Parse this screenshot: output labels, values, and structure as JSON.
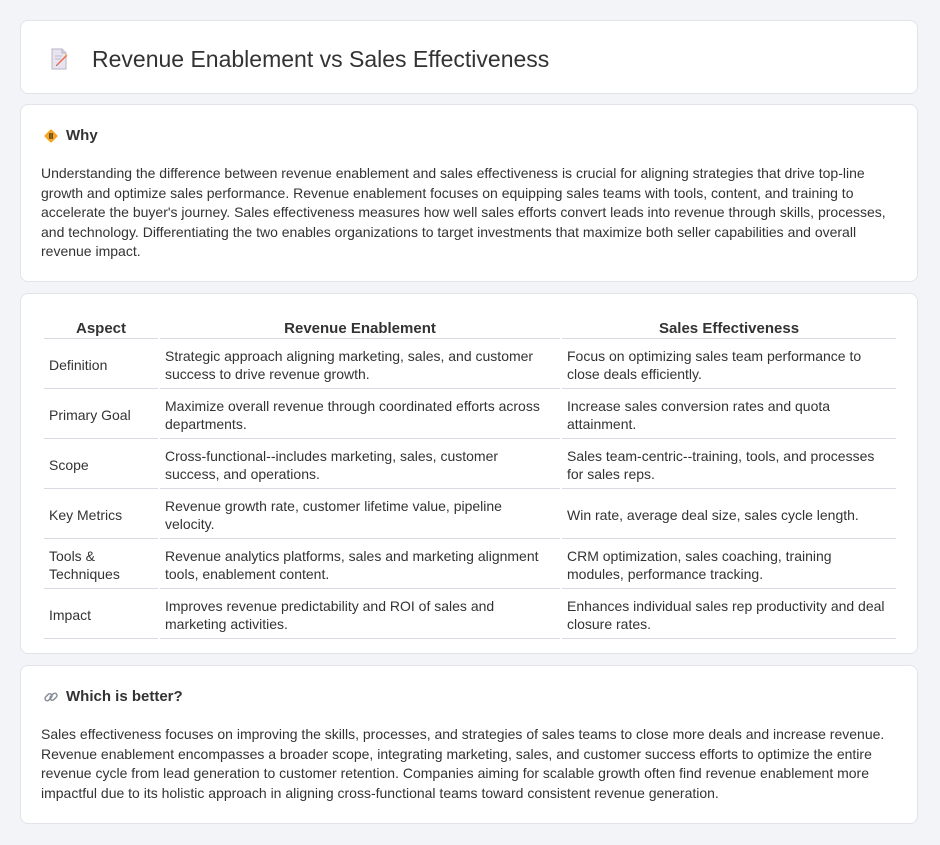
{
  "header": {
    "title": "Revenue Enablement vs Sales Effectiveness",
    "icon": "document-pencil-icon"
  },
  "why": {
    "heading": "Why",
    "icon": "diamond-sign-icon",
    "body": "Understanding the difference between revenue enablement and sales effectiveness is crucial for aligning strategies that drive top-line growth and optimize sales performance. Revenue enablement focuses on equipping sales teams with tools, content, and training to accelerate the buyer's journey. Sales effectiveness measures how well sales efforts convert leads into revenue through skills, processes, and technology. Differentiating the two enables organizations to target investments that maximize both seller capabilities and overall revenue impact."
  },
  "comparison": {
    "columns": [
      "Aspect",
      "Revenue Enablement",
      "Sales Effectiveness"
    ],
    "rows": [
      [
        "Definition",
        "Strategic approach aligning marketing, sales, and customer success to drive revenue growth.",
        "Focus on optimizing sales team performance to close deals efficiently."
      ],
      [
        "Primary Goal",
        "Maximize overall revenue through coordinated efforts across departments.",
        "Increase sales conversion rates and quota attainment."
      ],
      [
        "Scope",
        "Cross-functional--includes marketing, sales, customer success, and operations.",
        "Sales team-centric--training, tools, and processes for sales reps."
      ],
      [
        "Key Metrics",
        "Revenue growth rate, customer lifetime value, pipeline velocity.",
        "Win rate, average deal size, sales cycle length."
      ],
      [
        "Tools & Techniques",
        "Revenue analytics platforms, sales and marketing alignment tools, enablement content.",
        "CRM optimization, sales coaching, training modules, performance tracking."
      ],
      [
        "Impact",
        "Improves revenue predictability and ROI of sales and marketing activities.",
        "Enhances individual sales rep productivity and deal closure rates."
      ]
    ]
  },
  "better": {
    "heading": "Which is better?",
    "icon": "link-icon",
    "body": "Sales effectiveness focuses on improving the skills, processes, and strategies of sales teams to close more deals and increase revenue. Revenue enablement encompasses a broader scope, integrating marketing, sales, and customer success efforts to optimize the entire revenue cycle from lead generation to customer retention. Companies aiming for scalable growth often find revenue enablement more impactful due to its holistic approach in aligning cross-functional teams toward consistent revenue generation."
  },
  "colors": {
    "background": "#f3f4f8",
    "card": "#ffffff",
    "text": "#333333",
    "divider": "#d8dbe1",
    "icon_accent": "#f5a623"
  }
}
